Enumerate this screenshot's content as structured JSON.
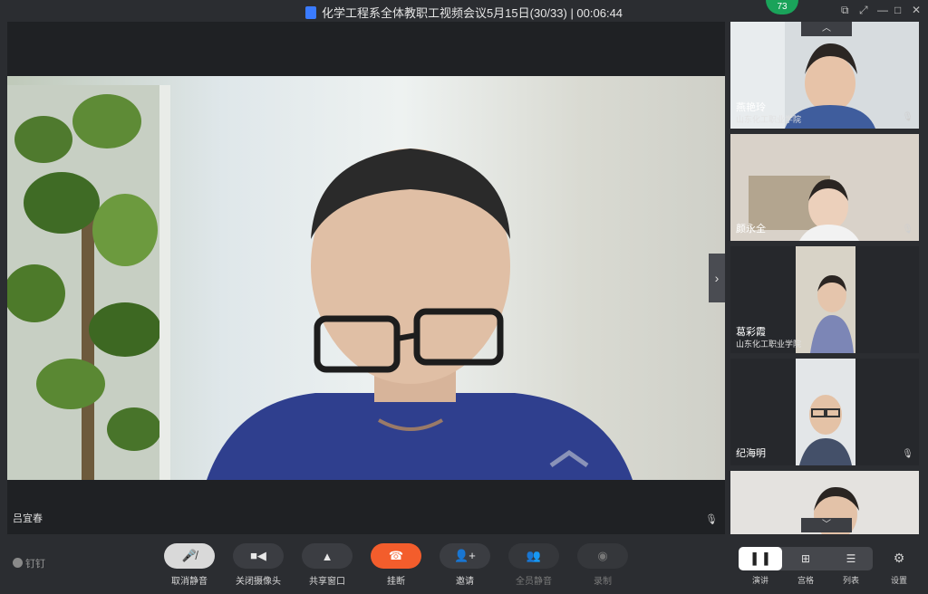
{
  "window": {
    "title": "化学工程系全体教职工视频会议5月15日(30/33) | 00:06:44",
    "badge": "73",
    "controls": [
      "⧉",
      "⤢",
      "—",
      "□",
      "✕"
    ]
  },
  "main_video": {
    "speaker_name": "吕宜春",
    "mic_icon": "mic-icon",
    "next_icon": "chevron-right-icon"
  },
  "participants": [
    {
      "name": "燕艳玲",
      "org": "山东化工职业学院",
      "mic": "mic-icon"
    },
    {
      "name": "颜永全",
      "org": "",
      "mic": "mic-icon"
    },
    {
      "name": "葛彩霞",
      "org": "山东化工职业学院",
      "mic": ""
    },
    {
      "name": "纪海明",
      "org": "",
      "mic": "mic-icon"
    },
    {
      "name": "",
      "org": "",
      "mic": ""
    }
  ],
  "toolbar": {
    "brand": "钉钉",
    "buttons": [
      {
        "label": "取消静音",
        "icon": "mic-off-icon",
        "state": "active"
      },
      {
        "label": "关闭摄像头",
        "icon": "camera-icon",
        "state": "normal"
      },
      {
        "label": "共享窗口",
        "icon": "share-icon",
        "state": "normal"
      },
      {
        "label": "挂断",
        "icon": "hangup-icon",
        "state": "hang"
      },
      {
        "label": "邀请",
        "icon": "invite-icon",
        "state": "normal"
      },
      {
        "label": "全员静音",
        "icon": "mute-all-icon",
        "state": "disabled"
      },
      {
        "label": "录制",
        "icon": "record-icon",
        "state": "disabled"
      }
    ],
    "layouts": [
      {
        "label": "演讲",
        "icon": "speaker-layout-icon",
        "active": true
      },
      {
        "label": "宫格",
        "icon": "grid-layout-icon",
        "active": false
      },
      {
        "label": "列表",
        "icon": "list-layout-icon",
        "active": false
      }
    ],
    "settings_label": "设置"
  },
  "colors": {
    "background": "#2b2d31",
    "hangup": "#f35d2c",
    "badge": "#1aa35a"
  }
}
